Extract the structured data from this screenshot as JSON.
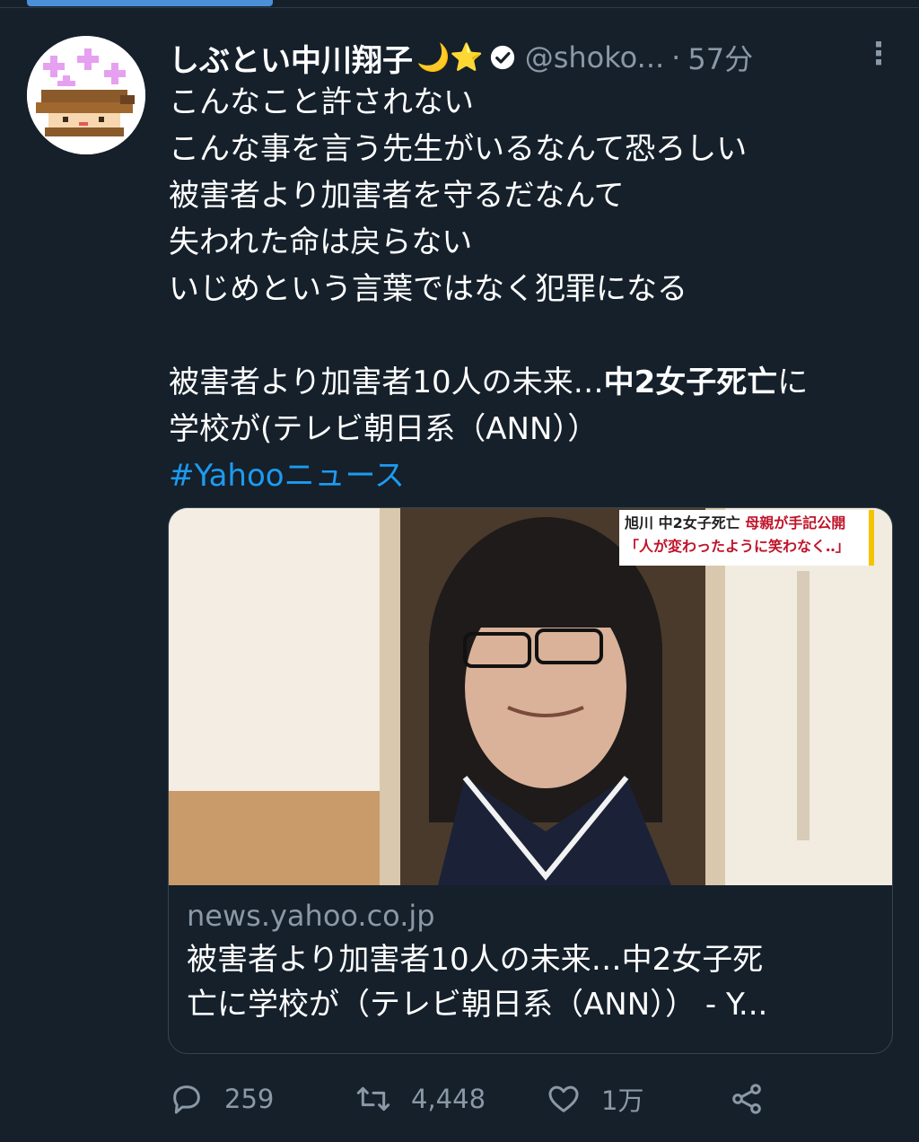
{
  "tweet": {
    "display_name": "しぶとい中川翔子",
    "emoji": "🌙⭐",
    "handle": "@shoko...",
    "separator": "·",
    "time": "57分",
    "more_icon": "⋮",
    "lines": [
      "こんなこと許されない",
      "こんな事を言う先生がいるなんて恐ろしい",
      "被害者より加害者を守るだなんて",
      "失われた命は戻らない",
      "いじめという言葉ではなく犯罪になる"
    ],
    "link_text_part1": "被害者より加害者10人の未来…",
    "link_text_bold": "中2女子死亡",
    "link_text_part2": "に",
    "link_text_line2": "学校が(テレビ朝日系（ANN））",
    "hashtag": "#Yahooニュース"
  },
  "card": {
    "caption_line1_a": "旭川 中2女子死亡 ",
    "caption_line1_b": "母親が手記公開",
    "caption_line2": "「人が変わったように笑わなく‥」",
    "domain": "news.yahoo.co.jp",
    "title_line1": "被害者より加害者10人の未来…中2女子死",
    "title_line2": "亡に学校が（テレビ朝日系（ANN））  - Y..."
  },
  "actions": {
    "reply_count": "259",
    "retweet_count": "4,448",
    "like_count": "1万"
  },
  "icons": {
    "verified": "verified-badge-icon",
    "reply": "reply-icon",
    "retweet": "retweet-icon",
    "like": "heart-icon",
    "share": "share-icon"
  },
  "colors": {
    "background": "#15202b",
    "link": "#1d9bf0",
    "muted": "#8b98a5"
  }
}
